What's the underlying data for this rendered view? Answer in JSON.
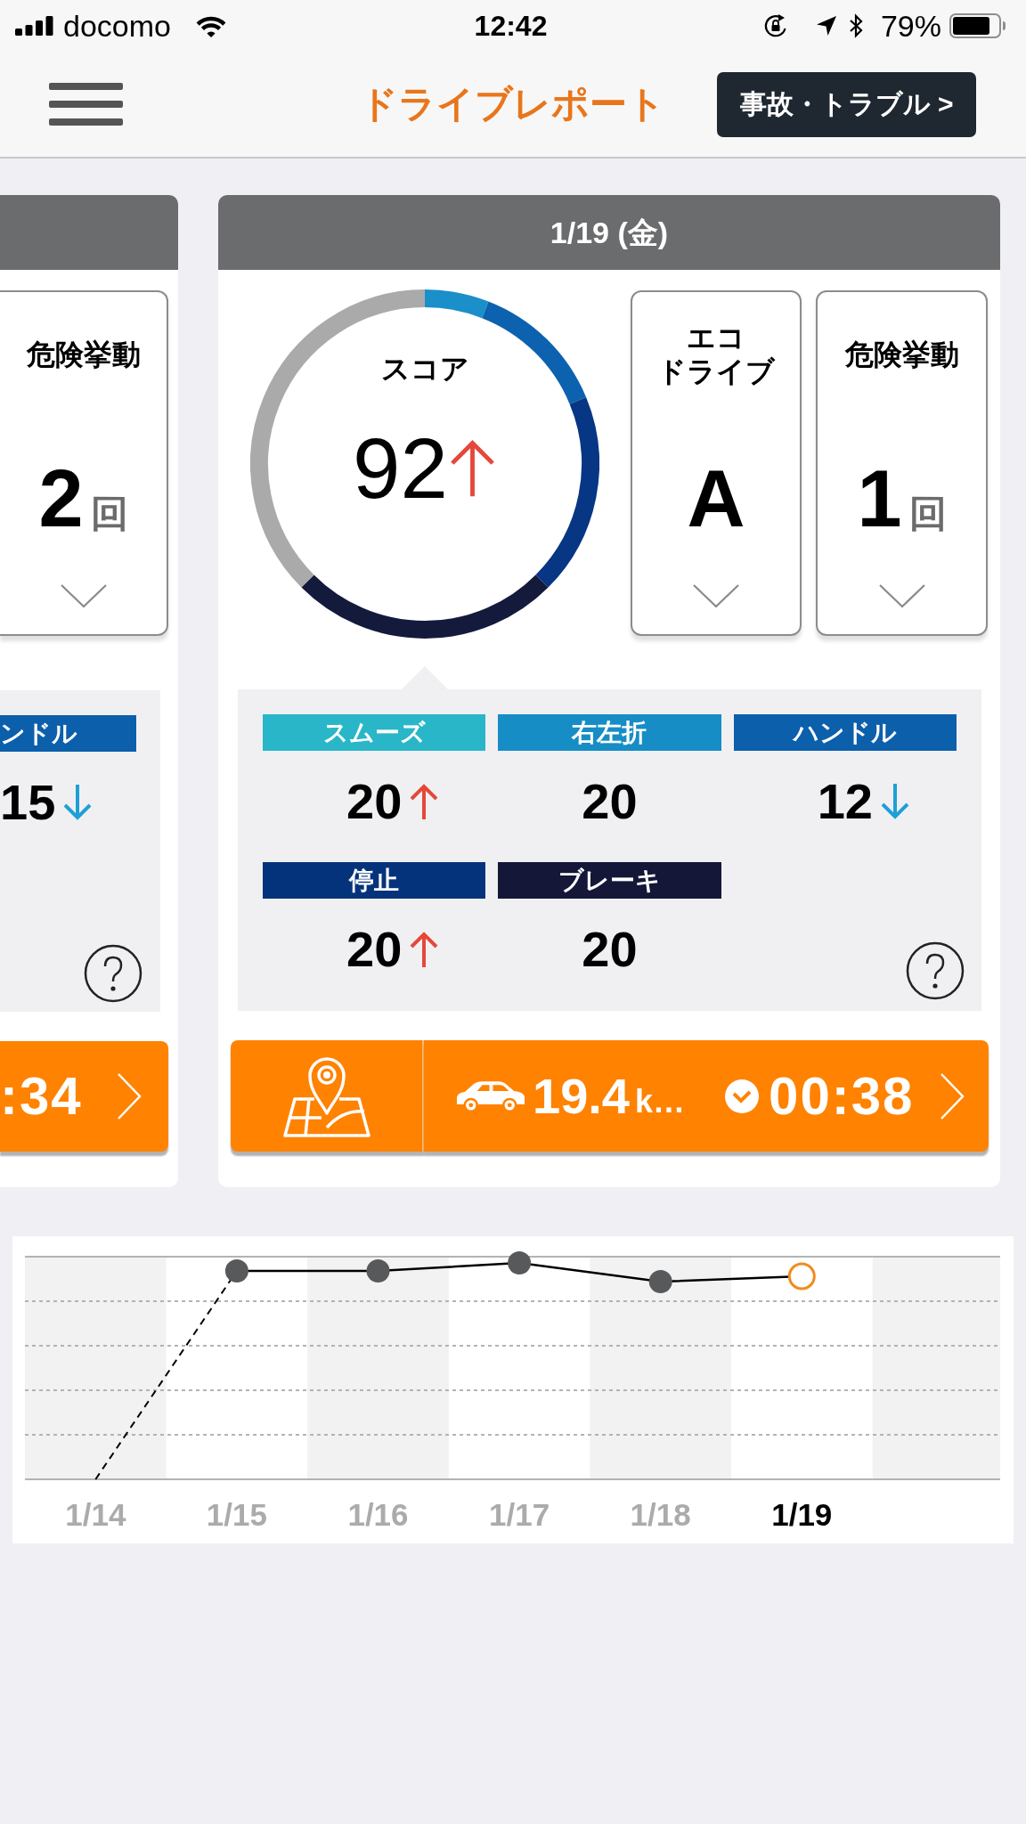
{
  "status_bar": {
    "carrier": "docomo",
    "time": "12:42",
    "battery": "79%"
  },
  "header": {
    "title": "ドライブレポート",
    "trouble_button": "事故・トラブル >"
  },
  "previous_card": {
    "summary_cards": [
      {
        "title_lines": [
          "危険挙動"
        ],
        "value": "2",
        "unit": "回"
      }
    ],
    "categories": [
      {
        "label": "ンドル",
        "value": "15",
        "trend_up": false,
        "trend_down": true,
        "color": "#0c5fab"
      }
    ],
    "trip": {
      "duration": ":34"
    }
  },
  "day_card": {
    "date": "1/19 (金)",
    "score": {
      "label": "スコア",
      "value": "92",
      "trend_up": true,
      "trend_down": false
    },
    "summary_cards": [
      {
        "title_lines": [
          "エコ",
          "ドライブ"
        ],
        "value": "A"
      },
      {
        "title_lines": [
          "危険挙動"
        ],
        "value": "1",
        "unit": "回"
      }
    ],
    "categories": [
      {
        "label": "スムーズ",
        "value": "20",
        "trend_up": true,
        "trend_down": false,
        "color": "#29b6c8"
      },
      {
        "label": "右左折",
        "value": "20",
        "trend_up": false,
        "trend_down": false,
        "color": "#168dc5"
      },
      {
        "label": "ハンドル",
        "value": "12",
        "trend_up": false,
        "trend_down": true,
        "color": "#0c5fab"
      },
      {
        "label": "停止",
        "value": "20",
        "trend_up": true,
        "trend_down": false,
        "color": "#05337b"
      },
      {
        "label": "ブレーキ",
        "value": "20",
        "trend_up": false,
        "trend_down": false,
        "color": "#141737"
      }
    ],
    "trip": {
      "distance": "19.4",
      "distance_unit": "k…",
      "duration": "00:38"
    }
  },
  "chart": {
    "days": [
      {
        "label": "1/14",
        "selected": false
      },
      {
        "label": "1/15",
        "selected": false
      },
      {
        "label": "1/16",
        "selected": false
      },
      {
        "label": "1/17",
        "selected": false
      },
      {
        "label": "1/18",
        "selected": false
      },
      {
        "label": "1/19",
        "selected": true
      }
    ]
  }
}
